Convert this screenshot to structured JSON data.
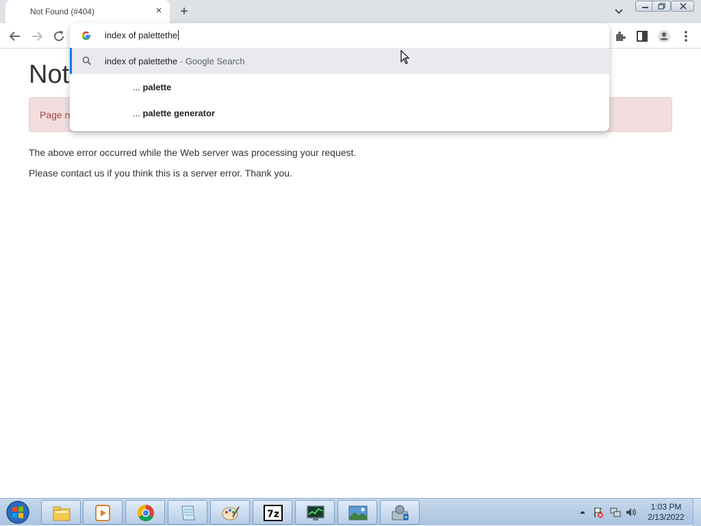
{
  "browser": {
    "tab_title": "Not Found (#404)",
    "new_tab_label": "+",
    "tab_close_label": "×",
    "omnibox": {
      "value": "index of palettethe",
      "suggestions": [
        {
          "prefix": "index of palettethe",
          "suffix": "- Google Search",
          "icon": "search-icon"
        },
        {
          "ellipsis": "...",
          "bold": "palette"
        },
        {
          "ellipsis": "...",
          "bold": "palette generator"
        }
      ]
    }
  },
  "page": {
    "heading": "Not",
    "alert_text": "Page n",
    "paragraph1": "The above error occurred while the Web server was processing your request.",
    "paragraph2": "Please contact us if you think this is a server error. Thank you."
  },
  "taskbar": {
    "time": "1:03 PM",
    "date": "2/13/2022",
    "apps": [
      "file-explorer-icon",
      "media-player-icon",
      "chrome-icon",
      "notepad-icon",
      "paint-icon",
      "7zip-icon",
      "task-manager-icon",
      "photo-viewer-icon",
      "control-panel-icon"
    ],
    "sevenzip_label": "7z"
  },
  "colors": {
    "accent": "#1a73e8",
    "alert_bg": "#f2dede",
    "alert_text": "#a94442"
  }
}
